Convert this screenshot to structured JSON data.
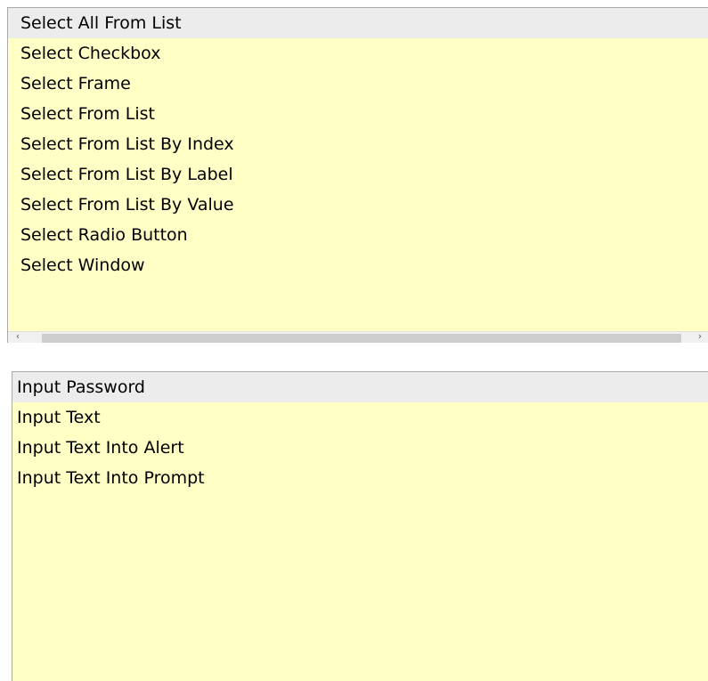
{
  "top_list": {
    "items": [
      "Select All From List",
      "Select Checkbox",
      "Select Frame",
      "Select From List",
      "Select From List By Index",
      "Select From List By Label",
      "Select From List By Value",
      "Select Radio Button",
      "Select Window"
    ],
    "selected_index": 0,
    "scrollbar": {
      "left_arrow_icon": "‹",
      "right_arrow_icon": "›"
    }
  },
  "bottom_list": {
    "items": [
      "Input Password",
      "Input Text",
      "Input Text Into Alert",
      "Input Text Into Prompt"
    ],
    "selected_index": 0
  },
  "colors": {
    "list_background": "#ffffc6",
    "selected_background": "#ececec",
    "border": "#a9a9a9"
  }
}
